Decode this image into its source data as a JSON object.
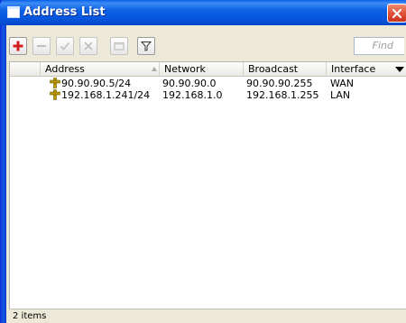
{
  "window": {
    "title": "Address List"
  },
  "toolbar": {
    "buttons": [
      {
        "icon": "add-icon",
        "enabled": true
      },
      {
        "icon": "remove-icon",
        "enabled": false
      },
      {
        "icon": "enable-check-icon",
        "enabled": false
      },
      {
        "icon": "disable-x-icon",
        "enabled": false
      },
      {
        "icon": "comment-icon",
        "enabled": false
      },
      {
        "icon": "filter-icon",
        "enabled": true
      }
    ],
    "find_placeholder": "Find"
  },
  "table": {
    "columns": [
      "Address",
      "Network",
      "Broadcast",
      "Interface"
    ],
    "sorted_by": "Address",
    "rows": [
      {
        "address": "90.90.90.5/24",
        "network": "90.90.90.0",
        "broadcast": "90.90.90.255",
        "interface": "WAN"
      },
      {
        "address": "192.168.1.241/24",
        "network": "192.168.1.0",
        "broadcast": "192.168.1.255",
        "interface": "LAN"
      }
    ]
  },
  "status": {
    "text": "2 items"
  },
  "colors": {
    "titlebar": "#0656dd",
    "close_button": "#e0533a",
    "row_icon": "#b89a00",
    "add_icon": "#d42020"
  }
}
